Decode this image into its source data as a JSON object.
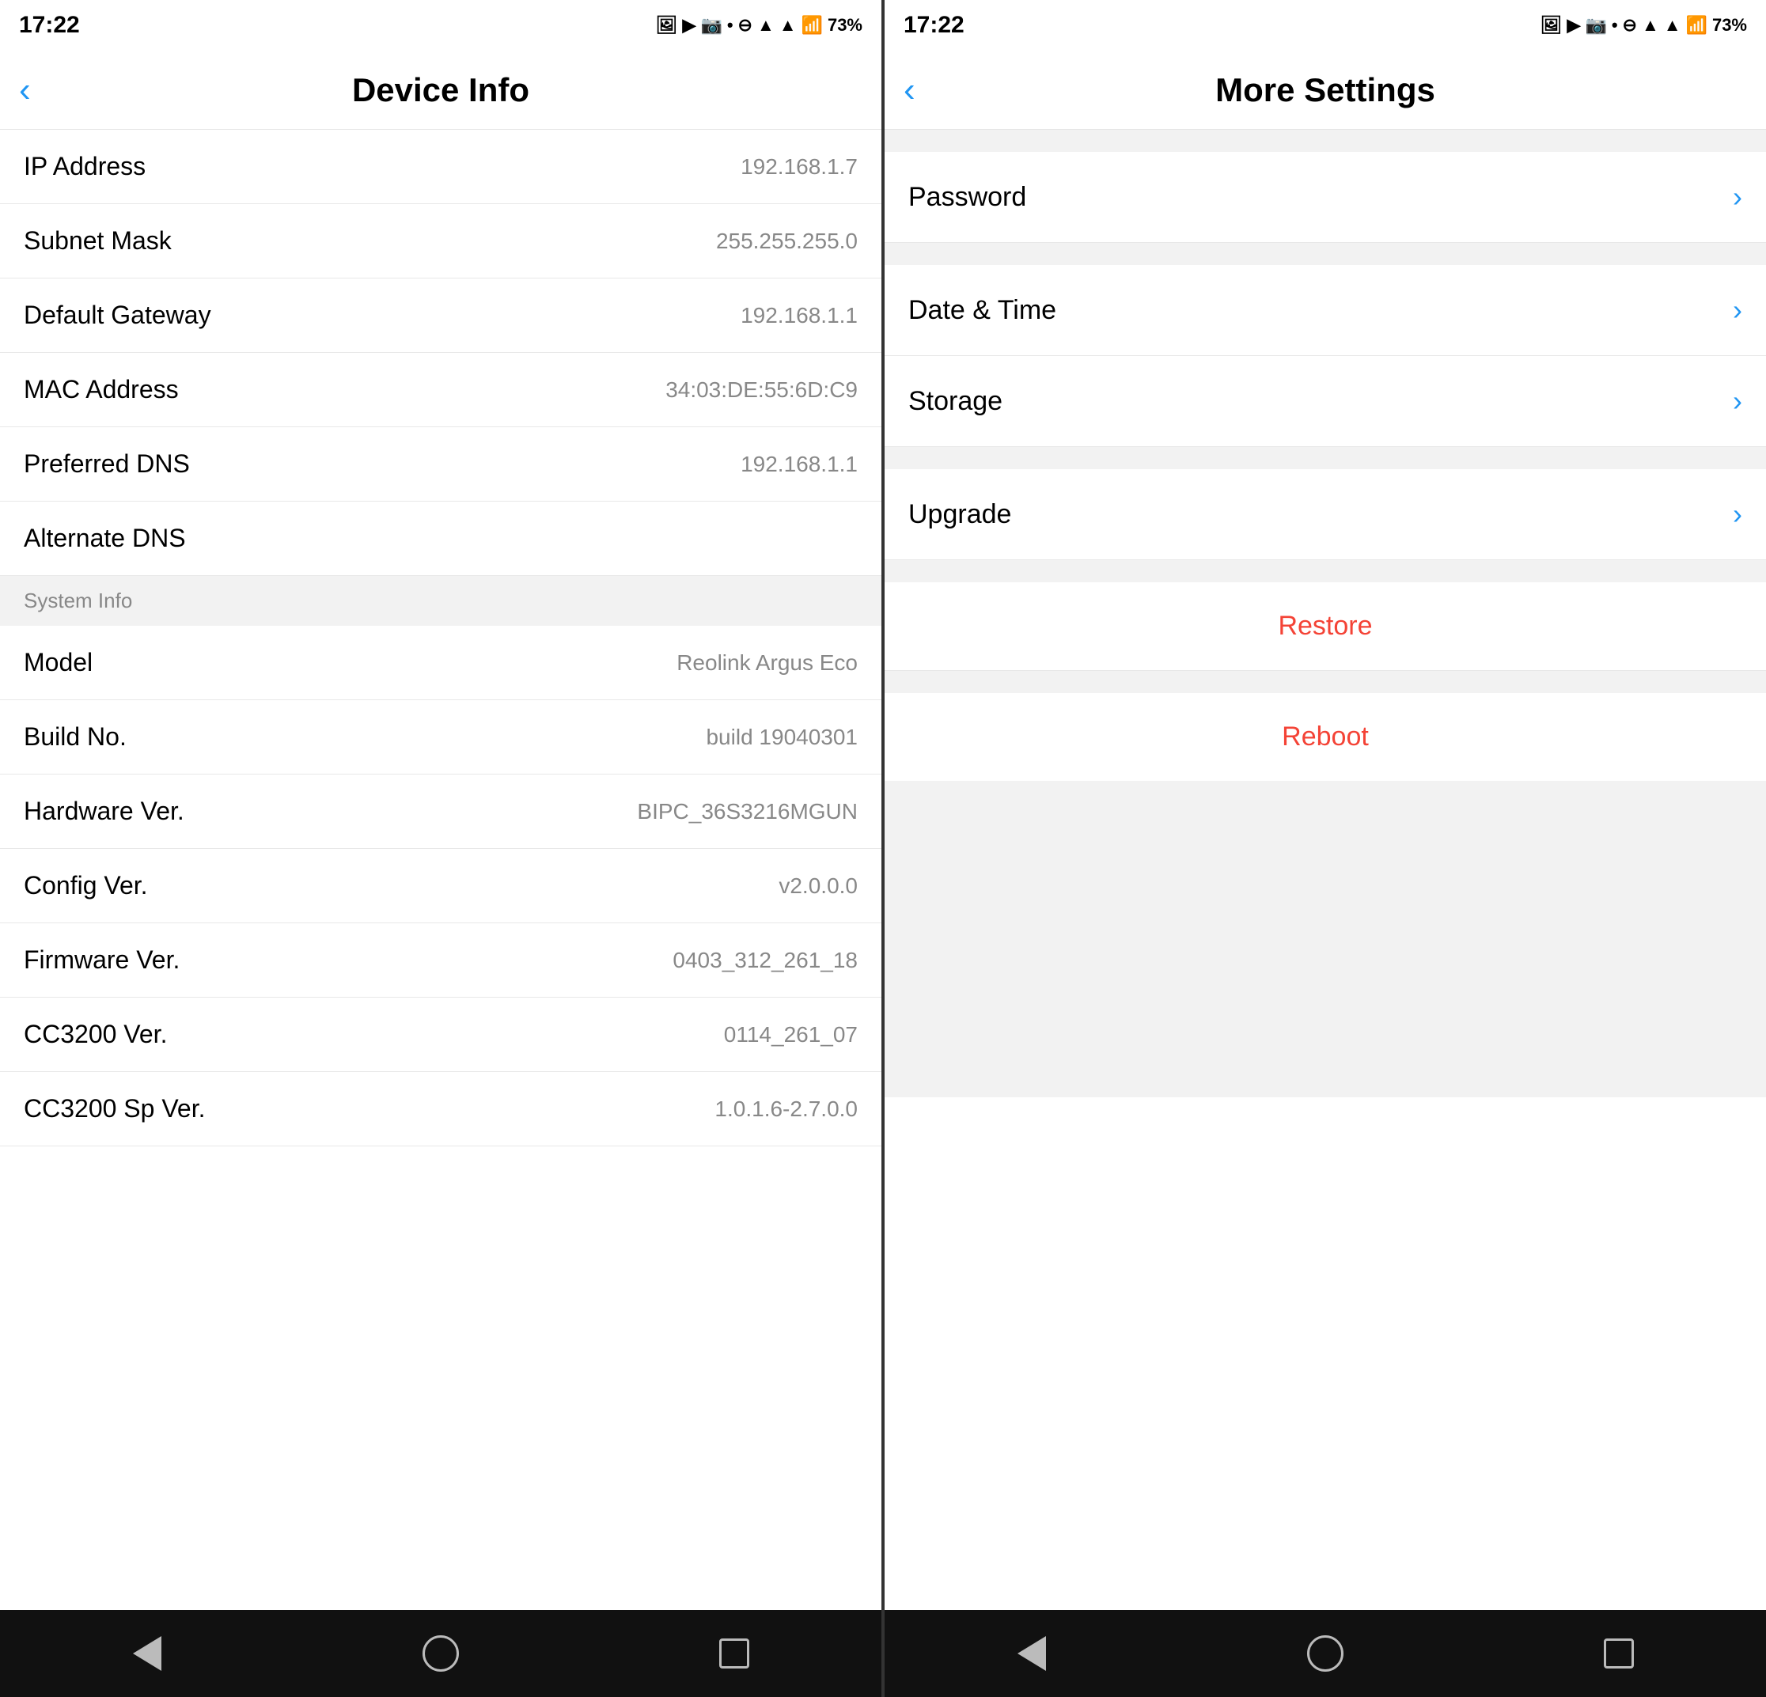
{
  "left_panel": {
    "status": {
      "time": "17:22",
      "battery": "73%"
    },
    "header": {
      "back_label": "‹",
      "title": "Device Info"
    },
    "network_info": [
      {
        "label": "IP Address",
        "value": "192.168.1.7"
      },
      {
        "label": "Subnet Mask",
        "value": "255.255.255.0"
      },
      {
        "label": "Default Gateway",
        "value": "192.168.1.1"
      },
      {
        "label": "MAC Address",
        "value": "34:03:DE:55:6D:C9"
      },
      {
        "label": "Preferred DNS",
        "value": "192.168.1.1"
      },
      {
        "label": "Alternate DNS",
        "value": ""
      }
    ],
    "system_section_label": "System Info",
    "system_info": [
      {
        "label": "Model",
        "value": "Reolink Argus Eco"
      },
      {
        "label": "Build No.",
        "value": "build 19040301"
      },
      {
        "label": "Hardware Ver.",
        "value": "BIPC_36S3216MGUN"
      },
      {
        "label": "Config Ver.",
        "value": "v2.0.0.0"
      },
      {
        "label": "Firmware Ver.",
        "value": "0403_312_261_18"
      },
      {
        "label": "CC3200 Ver.",
        "value": "0114_261_07"
      },
      {
        "label": "CC3200 Sp Ver.",
        "value": "1.0.1.6-2.7.0.0"
      }
    ],
    "nav": {
      "back_label": "back",
      "home_label": "home",
      "recent_label": "recent"
    }
  },
  "right_panel": {
    "status": {
      "time": "17:22",
      "battery": "73%"
    },
    "header": {
      "back_label": "‹",
      "title": "More Settings"
    },
    "settings": [
      {
        "label": "Password"
      },
      {
        "label": "Date & Time"
      },
      {
        "label": "Storage"
      },
      {
        "label": "Upgrade"
      }
    ],
    "actions": [
      {
        "label": "Restore",
        "class": "restore"
      },
      {
        "label": "Reboot",
        "class": "reboot"
      }
    ],
    "nav": {
      "back_label": "back",
      "home_label": "home",
      "recent_label": "recent"
    }
  }
}
